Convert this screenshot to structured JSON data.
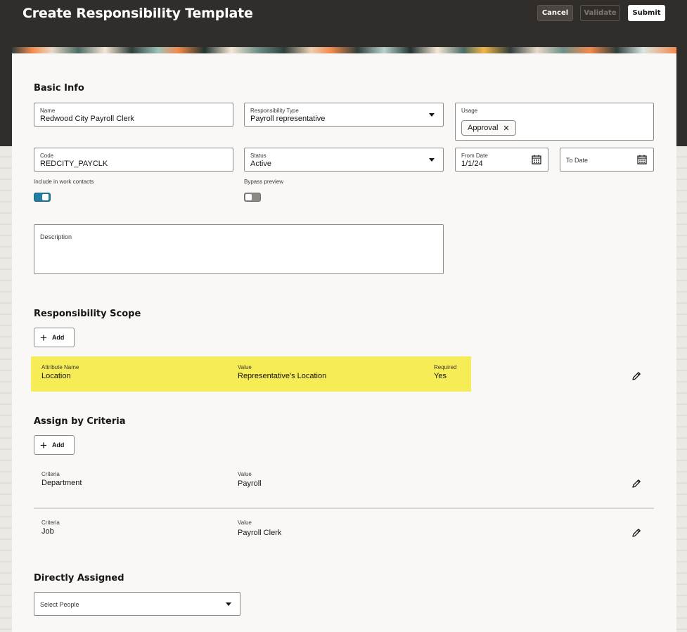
{
  "header": {
    "title": "Create Responsibility Template",
    "cancel_label": "Cancel",
    "validate_label": "Validate",
    "submit_label": "Submit"
  },
  "basic_info": {
    "title": "Basic Info",
    "name": {
      "label": "Name",
      "value": "Redwood City Payroll Clerk"
    },
    "responsibility_type": {
      "label": "Responsibility Type",
      "value": "Payroll representative"
    },
    "usage": {
      "label": "Usage",
      "chips": [
        "Approval"
      ]
    },
    "code": {
      "label": "Code",
      "value": "REDCITY_PAYCLK"
    },
    "status": {
      "label": "Status",
      "value": "Active"
    },
    "from_date": {
      "label": "From Date",
      "value": "1/1/24"
    },
    "to_date": {
      "label": "To Date",
      "value": ""
    },
    "include_work_contacts": {
      "label": "Include in work contacts",
      "on": true
    },
    "bypass_preview": {
      "label": "Bypass preview",
      "on": false
    },
    "description": {
      "label": "Description",
      "value": ""
    }
  },
  "responsibility_scope": {
    "title": "Responsibility Scope",
    "add_label": "Add",
    "columns": {
      "attribute": "Attribute Name",
      "value": "Value",
      "required": "Required"
    },
    "rows": [
      {
        "attribute": "Location",
        "value": "Representative's Location",
        "required": "Yes"
      }
    ]
  },
  "assign_by_criteria": {
    "title": "Assign by Criteria",
    "add_label": "Add",
    "columns": {
      "criteria": "Criteria",
      "value": "Value"
    },
    "rows": [
      {
        "criteria": "Department",
        "value": "Payroll"
      },
      {
        "criteria": "Job",
        "value": "Payroll Clerk"
      }
    ]
  },
  "directly_assigned": {
    "title": "Directly Assigned",
    "select_placeholder": "Select People"
  },
  "colors": {
    "header_bg": "#312d2a",
    "highlight": "#f6ec55",
    "toggle_on": "#227e9e"
  }
}
